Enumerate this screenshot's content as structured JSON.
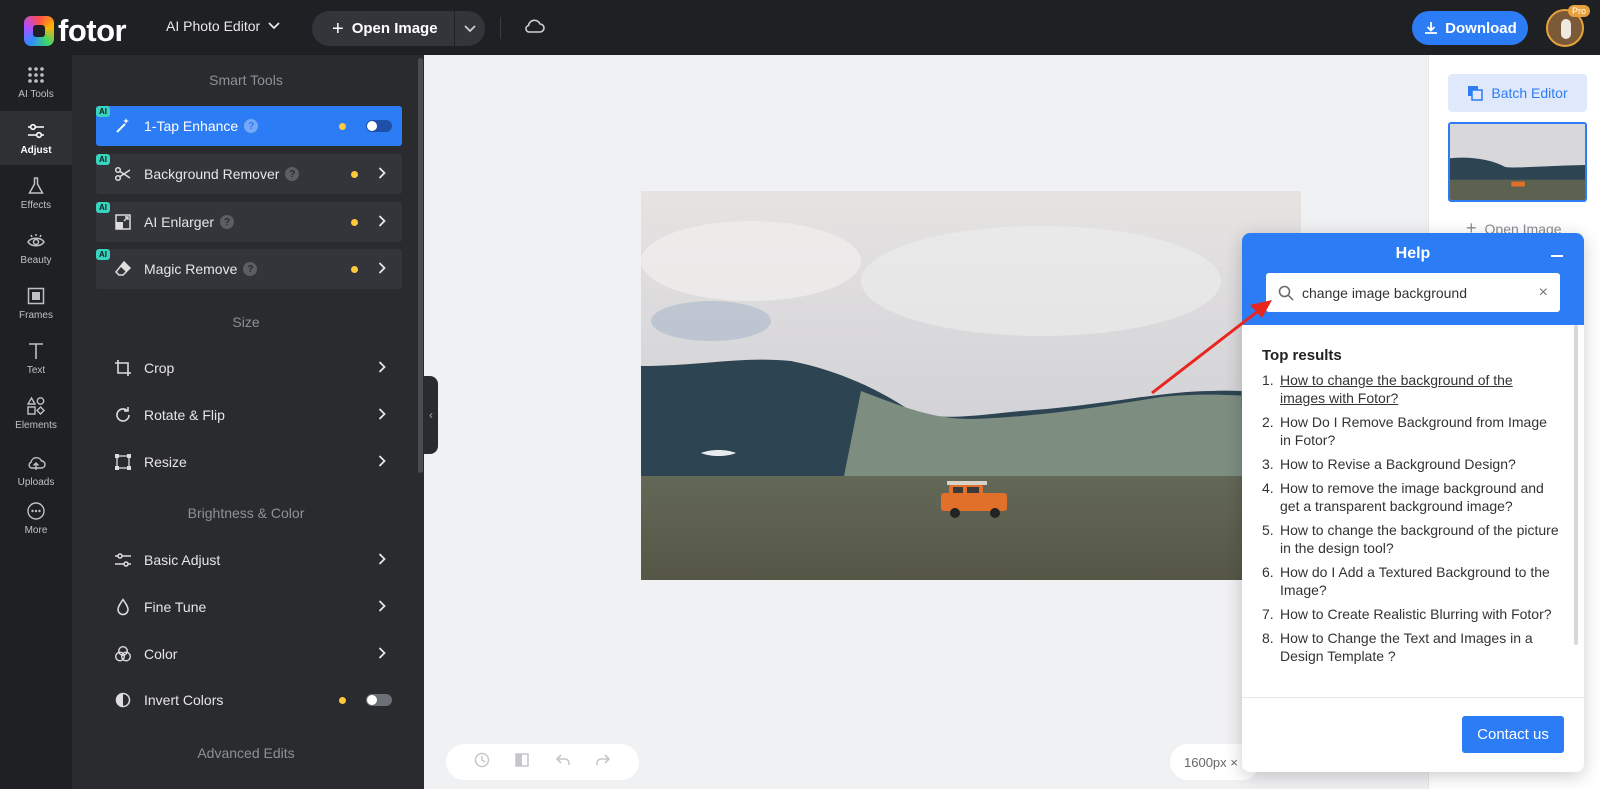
{
  "topbar": {
    "logo_text": "fotor",
    "mode_label": "AI Photo Editor",
    "open_image_label": "Open Image",
    "download_label": "Download",
    "pro_badge": "Pro"
  },
  "rail": {
    "items": [
      {
        "label": "AI Tools",
        "icon": "grid-dots-icon"
      },
      {
        "label": "Adjust",
        "icon": "sliders-icon"
      },
      {
        "label": "Effects",
        "icon": "flask-icon"
      },
      {
        "label": "Beauty",
        "icon": "eye-icon"
      },
      {
        "label": "Frames",
        "icon": "frame-icon"
      },
      {
        "label": "Text",
        "icon": "text-icon"
      },
      {
        "label": "Elements",
        "icon": "shapes-icon"
      },
      {
        "label": "Uploads",
        "icon": "upload-cloud-icon"
      },
      {
        "label": "More",
        "icon": "more-icon"
      }
    ]
  },
  "panel": {
    "smart_tools_title": "Smart Tools",
    "size_title": "Size",
    "brightness_title": "Brightness & Color",
    "advanced_title": "Advanced Edits",
    "ai_badge": "AI",
    "tools": {
      "enhance": "1-Tap Enhance",
      "bg_remover": "Background Remover",
      "enlarger": "AI Enlarger",
      "magic_remove": "Magic Remove",
      "crop": "Crop",
      "rotate": "Rotate & Flip",
      "resize": "Resize",
      "basic_adjust": "Basic Adjust",
      "fine_tune": "Fine Tune",
      "color": "Color",
      "invert": "Invert Colors"
    }
  },
  "canvas": {
    "size_text": "1600px ×"
  },
  "rightbar": {
    "batch_label": "Batch Editor",
    "open_image_label": "Open Image"
  },
  "help": {
    "title": "Help",
    "search_value": "change image background",
    "results_title": "Top results",
    "results": [
      {
        "num": "1.",
        "text": "How to change the background of the images with Fotor?"
      },
      {
        "num": "2.",
        "text": "How Do I Remove Background from Image in Fotor?"
      },
      {
        "num": "3.",
        "text": "How to Revise a Background Design?"
      },
      {
        "num": "4.",
        "text": "How to remove the image background and get a transparent background image?"
      },
      {
        "num": "5.",
        "text": "How to change the background of the picture in the design tool?"
      },
      {
        "num": "6.",
        "text": "How do I Add a Textured Background to the Image?"
      },
      {
        "num": "7.",
        "text": "How to Create Realistic Blurring with Fotor?"
      },
      {
        "num": "8.",
        "text": "How to Change the Text and Images in a Design Template ?"
      }
    ],
    "contact_label": "Contact us"
  },
  "colors": {
    "accent": "#2b7cf5",
    "dark_bg": "#1f2023",
    "panel_bg": "#2a2b2f",
    "indicator_dot": "#ffc83d",
    "ai_badge": "#39d3c0",
    "annotation_arrow": "#e8251e"
  }
}
